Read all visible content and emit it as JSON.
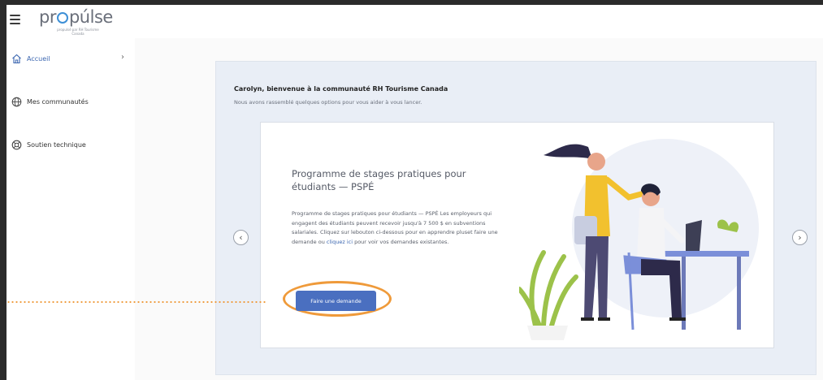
{
  "header": {
    "logo_text_pre": "pr",
    "logo_text_post": "púlse",
    "logo_tagline": "propulsé par RH Tourisme Canada"
  },
  "sidebar": {
    "items": [
      {
        "label": "Accueil",
        "icon": "home-icon",
        "active": true
      },
      {
        "label": "Mes communautés",
        "icon": "globe-icon"
      },
      {
        "label": "Soutien technique",
        "icon": "support-icon"
      }
    ]
  },
  "main": {
    "welcome_title": "Carolyn, bienvenue à la communauté RH Tourisme Canada",
    "welcome_subtitle": "Nous avons rassemblé quelques options pour vous aider à vous lancer.",
    "slide": {
      "title": "Programme de stages pratiques pour étudiants — PSPÉ",
      "body_text": "Programme de stages pratiques pour étudiants — PSPÉ Les employeurs qui engagent des étudiants peuvent recevoir jusqu'à 7 500 $ en subventions salariales. Cliquez sur lebouton ci-dessous pour en apprendre pluset faire une demande ou ",
      "link_text": "cliquez ici",
      "body_text_end": " pour voir vos demandes existantes.",
      "button_label": "Faire une demande"
    },
    "prev_icon": "chevron-left-icon",
    "next_icon": "chevron-right-icon"
  },
  "colors": {
    "accent": "#4a6fc0",
    "highlight": "#ef9a3a",
    "panel_bg": "#e9eef6"
  }
}
